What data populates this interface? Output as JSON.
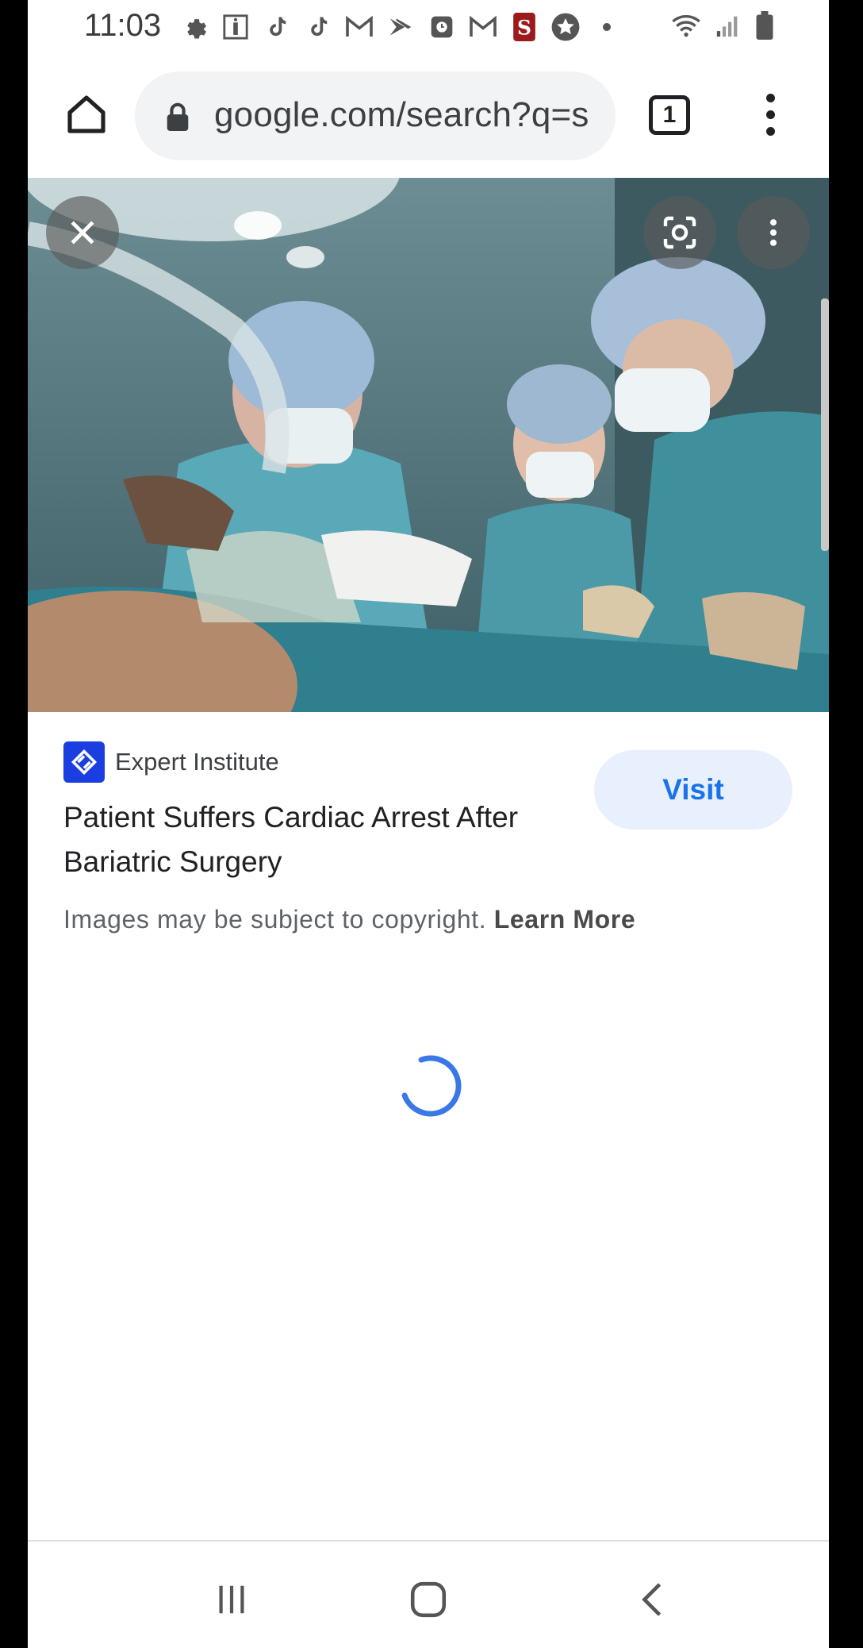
{
  "status_bar": {
    "time": "11:03",
    "icons": [
      "gear-icon",
      "robinhood-icon",
      "tiktok-icon",
      "tiktok-icon",
      "gmail-icon",
      "sprint-icon",
      "clock-app-icon",
      "gmail-icon",
      "stanford-icon",
      "star-icon",
      "dot-icon"
    ],
    "right_icons": [
      "wifi-icon",
      "signal-icon",
      "battery-icon"
    ]
  },
  "browser": {
    "url": "google.com/search?q=s",
    "tab_count": "1"
  },
  "image_viewer": {
    "image_description_icon": "surgery-photo",
    "source_name": "Expert Institute",
    "title": "Patient Suffers Cardiac Arrest After Bariatric Surgery",
    "visit_label": "Visit",
    "copyright_text": "Images may be subject to copyright.",
    "learn_more_label": "Learn More"
  },
  "colors": {
    "accent": "#1a73e8",
    "visit_bg": "#e8f0fe",
    "source_logo": "#1a3ee0"
  }
}
